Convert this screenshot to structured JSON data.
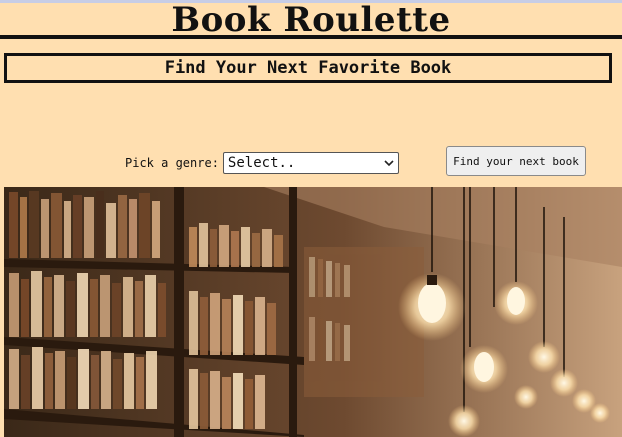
{
  "header": {
    "title": "Book Roulette",
    "tagline": "Find Your Next Favorite Book"
  },
  "form": {
    "genre_label": "Pick a genre:",
    "genre_selected": "Select..",
    "submit_label": "Find your next book"
  },
  "hero": {
    "description_icon": "library-bookshelf-photo"
  },
  "colors": {
    "page_background": "#ffdfb0",
    "border": "#111111"
  }
}
